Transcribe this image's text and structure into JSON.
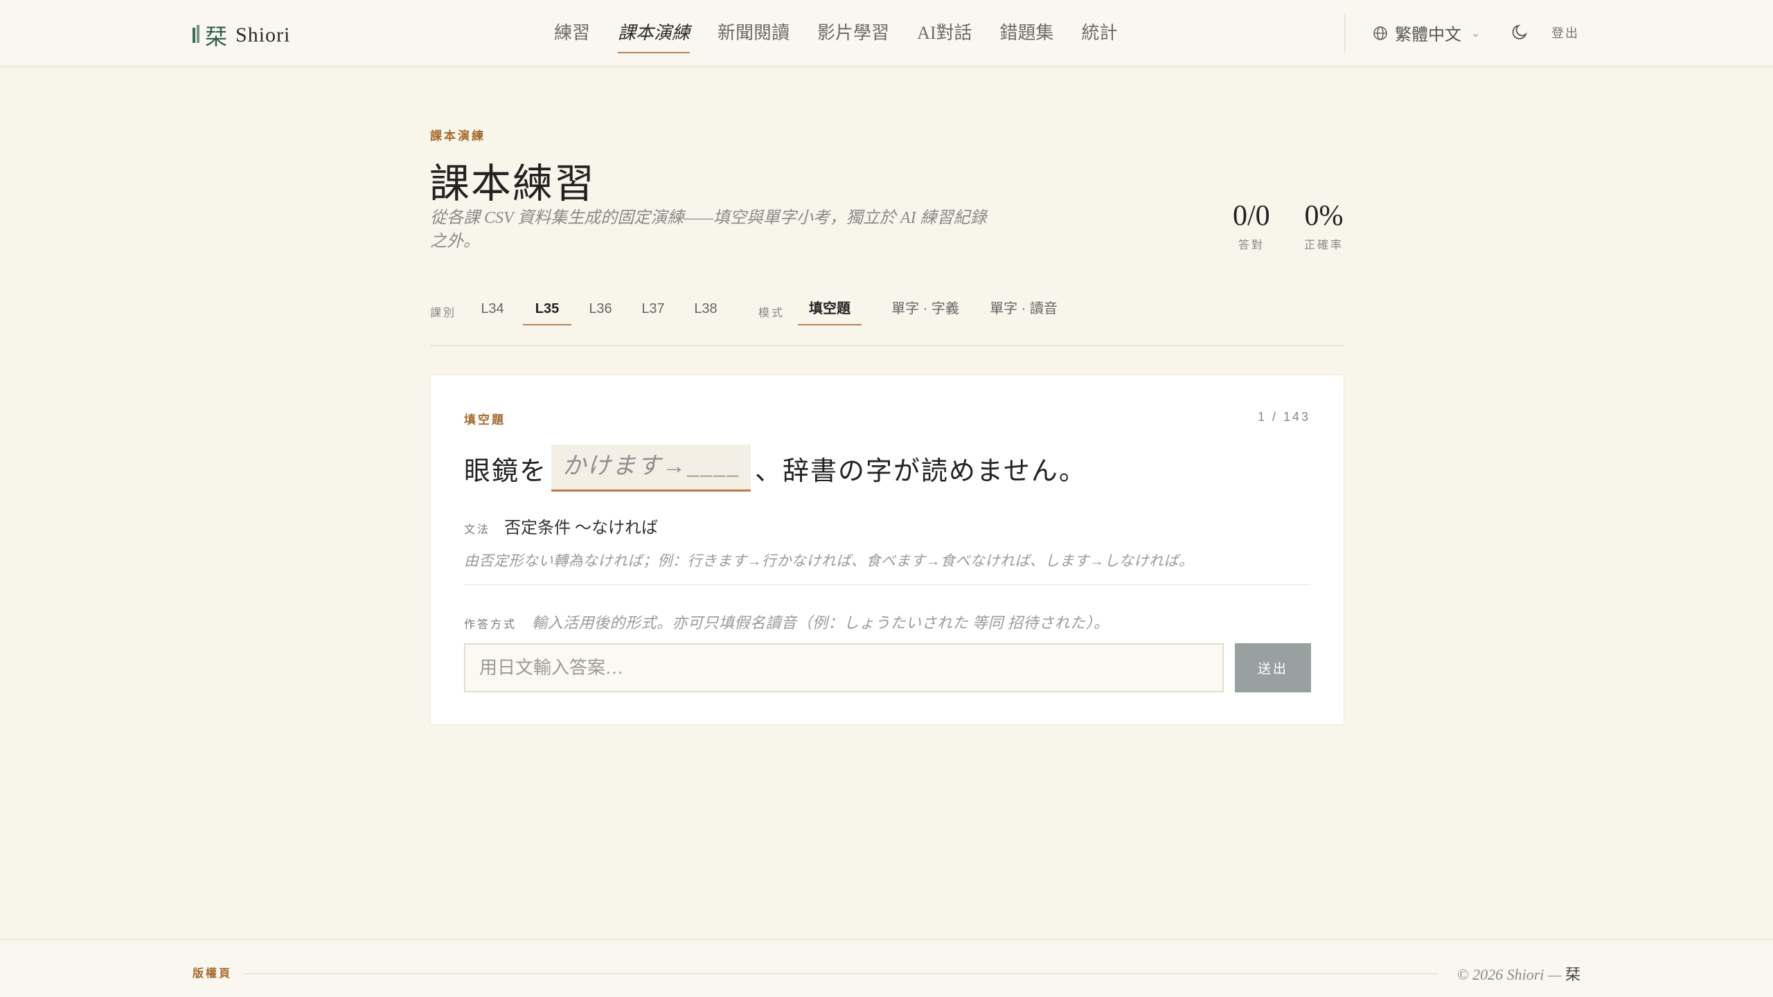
{
  "app": {
    "logo_kanji": "栞",
    "name": "Shiori"
  },
  "nav": {
    "items": [
      "練習",
      "課本演練",
      "新聞閱讀",
      "影片學習",
      "AI對話",
      "錯題集",
      "統計"
    ],
    "active_index": 1
  },
  "header": {
    "language": "繁體中文",
    "logout": "登出"
  },
  "page": {
    "eyebrow": "課本演練",
    "title": "課本練習",
    "subtitle": "從各課 CSV 資料集生成的固定演練——填空與單字小考，獨立於 AI 練習紀錄之外。"
  },
  "stats": [
    {
      "value": "0/0",
      "label": "答對"
    },
    {
      "value": "0%",
      "label": "正確率"
    }
  ],
  "filters": {
    "lesson_label": "課別",
    "lessons": [
      "L34",
      "L35",
      "L36",
      "L37",
      "L38"
    ],
    "active_lesson": "L35",
    "mode_label": "模式",
    "modes": [
      "填空題",
      "單字 · 字義",
      "單字 · 讀音"
    ],
    "active_mode": "填空題"
  },
  "card": {
    "tag": "填空題",
    "counter": "1 / 143",
    "question_pre": "眼鏡を",
    "blank_hint": "かけます→____",
    "question_post": "、辞書の字が読めません。",
    "grammar_label": "文法",
    "grammar_value": "否定条件 〜なければ",
    "grammar_note": "由否定形ない轉為なければ；例：行きます→行かなければ、食べます→食べなければ、します→しなければ。",
    "how_label": "作答方式",
    "how_value": "輸入活用後的形式。亦可只填假名讀音（例：しょうたいされた 等同 招待された）。",
    "answer_placeholder": "用日文輸入答案…",
    "submit_label": "送出"
  },
  "footer": {
    "tag": "版權頁",
    "copyright": "© 2026 Shiori —",
    "glyph": "栞"
  },
  "colors": {
    "background": "#f8f5ea",
    "accent": "#b5825a",
    "brand": "#2f5c4d",
    "eyebrow": "#a66a2e",
    "button": "#98a0a0"
  }
}
